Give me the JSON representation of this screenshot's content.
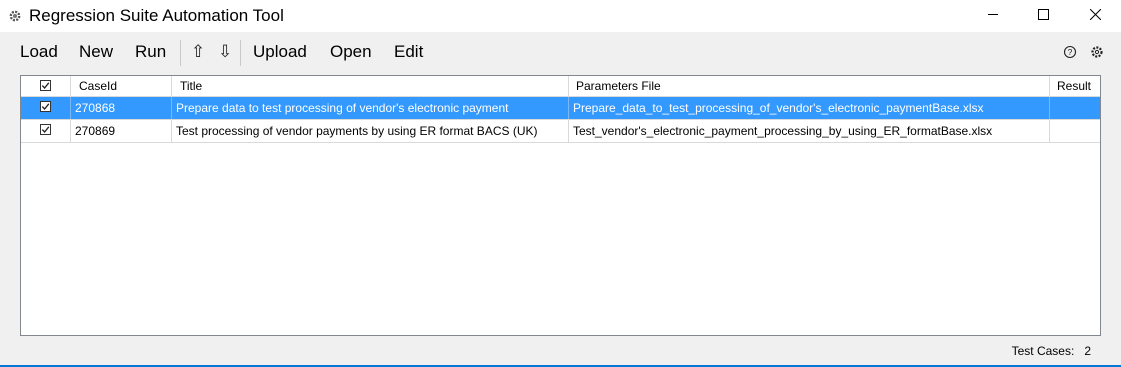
{
  "window": {
    "title": "Regression Suite Automation Tool",
    "icon": "gear-icon",
    "controls": [
      "minimize-icon",
      "maximize-icon",
      "close-icon"
    ]
  },
  "toolbar": {
    "load": "Load",
    "new": "New",
    "run": "Run",
    "move_up_icon": "arrow-up-icon",
    "move_down_icon": "arrow-down-icon",
    "upload": "Upload",
    "open": "Open",
    "edit": "Edit",
    "help_icon": "help-icon",
    "settings_icon": "gear-icon"
  },
  "grid": {
    "columns": [
      "CaseId",
      "Title",
      "Parameters File",
      "Result"
    ],
    "header_checked": true,
    "rows": [
      {
        "checked": true,
        "selected": true,
        "case_id": "270868",
        "title": "Prepare data to test processing of vendor's electronic payment",
        "parameters_file": "Prepare_data_to_test_processing_of_vendor's_electronic_paymentBase.xlsx",
        "result": ""
      },
      {
        "checked": true,
        "selected": false,
        "case_id": "270869",
        "title": "Test processing of vendor payments by using ER format BACS (UK)",
        "parameters_file": "Test_vendor's_electronic_payment_processing_by_using_ER_formatBase.xlsx",
        "result": ""
      }
    ]
  },
  "status": {
    "label": "Test Cases:",
    "count": "2"
  },
  "colors": {
    "selection": "#3399ff",
    "accent": "#0078d7",
    "background": "#f0f0f0"
  }
}
